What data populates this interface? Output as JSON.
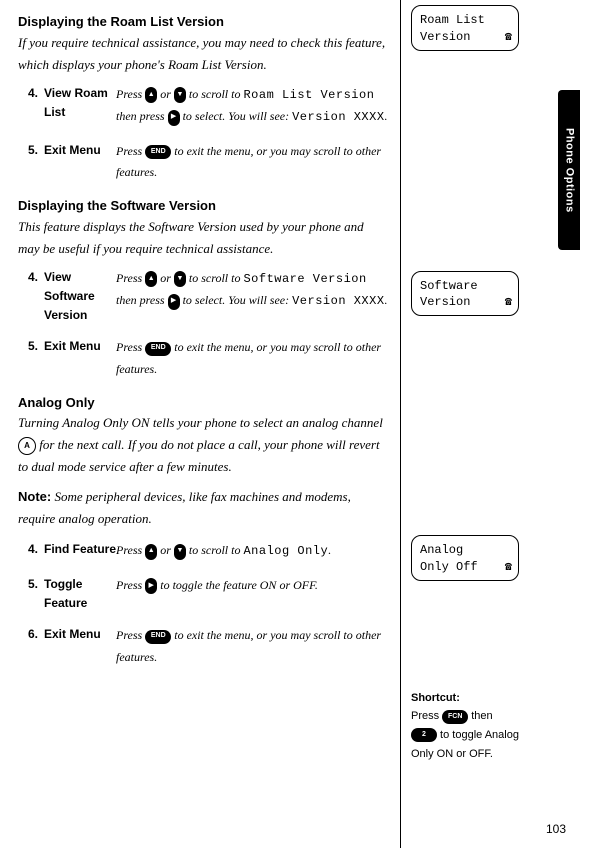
{
  "tab": "Phone Options",
  "pageNumber": "103",
  "sections": [
    {
      "heading": "Displaying the Roam List Version",
      "intro": "If you require technical assistance, you may need to check this feature, which displays your phone's Roam List Version.",
      "display": {
        "line1": "Roam List",
        "line2": "Version"
      },
      "steps": [
        {
          "num": "4.",
          "label": "View Roam List",
          "desc_pre": "Press ",
          "desc_mid1": " or ",
          "desc_mid2": " to scroll to ",
          "lcd1": "Roam List Version",
          "desc_mid3": " then press ",
          "desc_mid4": " to select. You will see: ",
          "lcd2": "Version XXXX",
          "desc_end": "."
        },
        {
          "num": "5.",
          "label": "Exit Menu",
          "desc_pre": "Press ",
          "desc_end": " to exit the menu, or you may scroll to other features."
        }
      ]
    },
    {
      "heading": "Displaying the Software Version",
      "intro": "This feature displays the Software Version used by your phone and may be useful if you require technical assistance.",
      "display": {
        "line1": "Software",
        "line2": "Version"
      },
      "steps": [
        {
          "num": "4.",
          "label": "View Software Version",
          "desc_pre": "Press ",
          "desc_mid1": " or ",
          "desc_mid2": " to scroll to ",
          "lcd1": "Software Version",
          "desc_mid3": " then press ",
          "desc_mid4": " to select. You will see: ",
          "lcd2": "Version XXXX",
          "desc_end": "."
        },
        {
          "num": "5.",
          "label": "Exit Menu",
          "desc_pre": "Press ",
          "desc_end": " to exit the menu, or you may scroll to other features."
        }
      ]
    },
    {
      "heading": "Analog Only",
      "intro_pre": "Turning Analog Only ON tells your phone to select an analog channel ",
      "intro_post": " for the next call. If you do not place a call, your phone will revert to dual mode service after a few minutes.",
      "note_label": "Note:",
      "note": " Some peripheral devices, like fax machines and modems, require analog operation.",
      "display": {
        "line1": "Analog",
        "line2": "Only Off"
      },
      "shortcut": {
        "title": "Shortcut:",
        "pre": "Press ",
        "mid": " then ",
        "post": " to toggle Analog Only ON or OFF.",
        "key1": "FCN",
        "key2": "2"
      },
      "steps": [
        {
          "num": "4.",
          "label": "Find Feature",
          "desc_pre": "Press ",
          "desc_mid1": " or ",
          "desc_mid2": " to scroll to ",
          "lcd1": "Analog Only",
          "desc_end": "."
        },
        {
          "num": "5.",
          "label": "Toggle Feature",
          "desc_pre": "Press ",
          "desc_end": " to toggle the feature ON or OFF."
        },
        {
          "num": "6.",
          "label": "Exit Menu",
          "desc_pre": "Press ",
          "desc_end": " to exit the menu, or you may scroll to other features."
        }
      ]
    }
  ],
  "keys": {
    "end": "END"
  }
}
